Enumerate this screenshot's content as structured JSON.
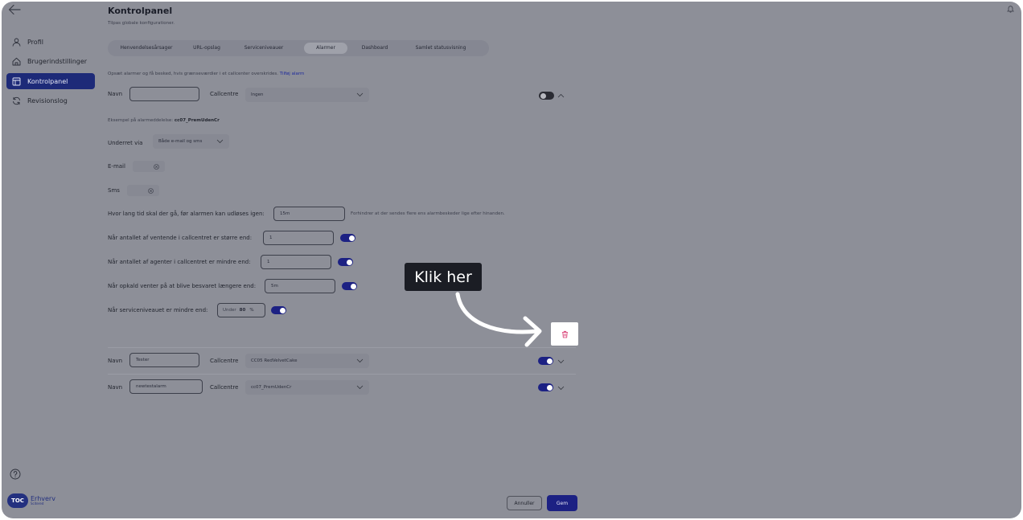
{
  "sidebar": {
    "items": [
      {
        "label": "Profil",
        "icon": "user-icon"
      },
      {
        "label": "Brugerindstillinger",
        "icon": "home-icon"
      },
      {
        "label": "Kontrolpanel",
        "icon": "layout-icon",
        "active": true
      },
      {
        "label": "Revisionslog",
        "icon": "refresh-icon"
      }
    ],
    "logo": {
      "badge": "TOC",
      "name": "Erhverv",
      "sub": "Scitered"
    }
  },
  "header": {
    "title": "Kontrolpanel",
    "subtitle": "Tilpas globale konfigurationer."
  },
  "tabs": [
    {
      "label": "Henvendelsesårsager"
    },
    {
      "label": "URL-opslag"
    },
    {
      "label": "Serviceniveauer"
    },
    {
      "label": "Alarmer",
      "active": true
    },
    {
      "label": "Dashboard"
    },
    {
      "label": "Samlet statusvisning"
    }
  ],
  "description": {
    "text": "Opsæt alarmer og få besked, hvis grænseværdier i et callcenter overskrides.",
    "link": "Tilføj alarm"
  },
  "alarm_form": {
    "name_label": "Navn",
    "name_value": "",
    "callcentre_label": "Callcentre",
    "callcentre_value": "Ingen",
    "enabled": false,
    "example_prefix": "Eksempel på alarmeddelelse:",
    "example_value": "cc07_PremUdenCr",
    "notify_label": "Underret via",
    "notify_value": "Både e-mail og sms",
    "email_label": "E-mail",
    "sms_label": "Sms",
    "cooldown_label": "Hvor lang tid skal der gå, før alarmen kan udløses igen:",
    "cooldown_value": "15m",
    "cooldown_hint": "Forhindrer at der sendes flere ens alarmbeskeder lige efter hinanden.",
    "conditions": [
      {
        "label": "Når antallet af ventende i callcentret er større end:",
        "value": "1",
        "enabled": true
      },
      {
        "label": "Når antallet af agenter i callcentret er mindre end:",
        "value": "1",
        "enabled": true
      },
      {
        "label": "Når opkald venter på at blive besvaret længere end:",
        "value": "5m",
        "enabled": true
      }
    ],
    "service_level": {
      "label": "Når serviceniveauet er mindre end:",
      "prefix": "Under",
      "value": "80",
      "unit": "%",
      "enabled": true
    }
  },
  "alarms": [
    {
      "name_label": "Navn",
      "name": "Tester",
      "callcentre_label": "Callcentre",
      "callcentre": "CC05 RedVelvetCake",
      "enabled": true
    },
    {
      "name_label": "Navn",
      "name": "newtestalarm",
      "callcentre_label": "Callcentre",
      "callcentre": "cc07_PremUdenCr",
      "enabled": true
    }
  ],
  "tooltip": {
    "text": "Klik her"
  },
  "footer": {
    "cancel": "Annuller",
    "save": "Gem"
  },
  "colors": {
    "primary": "#1c2183",
    "overlay": "#8d8f98",
    "tooltip_bg": "#1b1d24",
    "delete": "#d6336c"
  }
}
